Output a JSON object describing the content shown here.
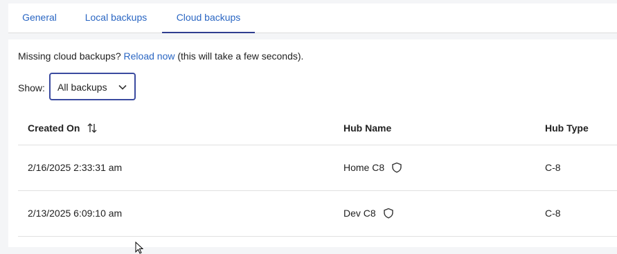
{
  "tabs": [
    {
      "label": "General",
      "active": false
    },
    {
      "label": "Local backups",
      "active": false
    },
    {
      "label": "Cloud backups",
      "active": true
    }
  ],
  "notice": {
    "prefix": "Missing cloud backups?",
    "link": "Reload now",
    "suffix": "(this will take a few seconds)."
  },
  "filter": {
    "label": "Show:",
    "selected": "All backups"
  },
  "table": {
    "columns": [
      "Created On",
      "Hub Name",
      "Hub Type"
    ],
    "rows": [
      {
        "created": "2/16/2025 2:33:31 am",
        "hub_name": "Home C8",
        "hub_type": "C-8"
      },
      {
        "created": "2/13/2025 6:09:10 am",
        "hub_name": "Dev C8",
        "hub_type": "C-8"
      }
    ]
  },
  "icons": {
    "sort": "sort-arrows-icon",
    "hub": "shield-icon",
    "dropdown": "chevron-down-icon"
  },
  "colors": {
    "accent": "#2a66c3",
    "select_border": "#3a4a9f",
    "active_tab_underline": "#2f3d8f"
  }
}
